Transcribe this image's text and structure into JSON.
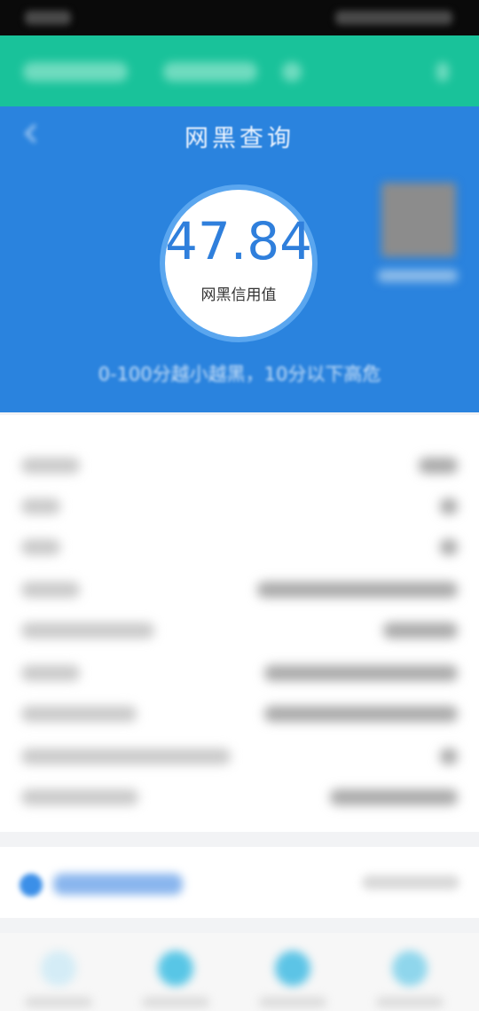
{
  "header": {
    "title": "网黑查询",
    "score": "47.84",
    "score_label": "网黑信用值",
    "hint": "0-100分越小越黑，10分以下高危"
  },
  "colors": {
    "header_blue": "#2a83de",
    "green_bar": "#19c29a",
    "score_text": "#2f7fdc"
  },
  "icons": {
    "back": "back-arrow-icon",
    "qr": "qr-code-icon"
  }
}
